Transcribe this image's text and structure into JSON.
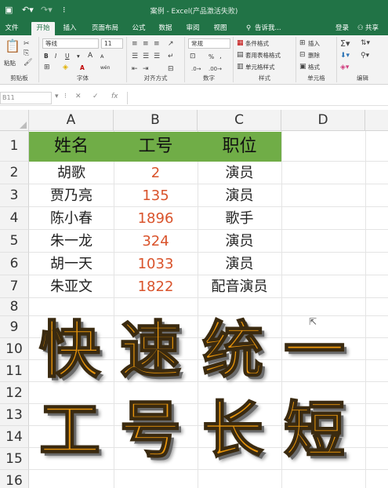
{
  "titlebar": {
    "title": "案例 - Excel(产品激活失败)",
    "save_icon": "save-icon",
    "undo_icon": "undo-icon",
    "redo_icon": "redo-icon"
  },
  "tabs": [
    "文件",
    "开始",
    "插入",
    "页面布局",
    "公式",
    "数据",
    "审阅",
    "视图"
  ],
  "active_tab": "开始",
  "tell_me": "告诉我...",
  "login": "登录",
  "share": "共享",
  "ribbon": {
    "clipboard": {
      "paste": "粘贴",
      "label": "剪贴板"
    },
    "font": {
      "name": "等线",
      "size": "11",
      "bold": "B",
      "italic": "I",
      "underline": "U",
      "grow": "A",
      "shrink": "A",
      "color_a": "A",
      "wen": "wén",
      "label": "字体"
    },
    "alignment": {
      "label": "对齐方式"
    },
    "number": {
      "format": "常规",
      "label": "数字",
      "percent": "%"
    },
    "styles": {
      "conditional": "条件格式",
      "table": "套用表格格式",
      "cell": "单元格样式",
      "label": "样式"
    },
    "cells": {
      "insert": "插入",
      "delete": "删除",
      "format": "格式",
      "label": "单元格"
    },
    "editing": {
      "label": "编辑"
    }
  },
  "formula_bar": {
    "name_box": "B11",
    "cancel": "✕",
    "enter": "✓",
    "fx": "fx",
    "value": ""
  },
  "columns": [
    "A",
    "B",
    "C",
    "D"
  ],
  "rows": [
    "1",
    "2",
    "3",
    "4",
    "5",
    "6",
    "7",
    "8",
    "9",
    "10",
    "11",
    "12",
    "13",
    "14",
    "15",
    "16"
  ],
  "table": {
    "headers": [
      "姓名",
      "工号",
      "职位"
    ],
    "header_color": "#70ad47",
    "number_color": "#d9532b",
    "data": [
      [
        "胡歌",
        "2",
        "演员"
      ],
      [
        "贾乃亮",
        "135",
        "演员"
      ],
      [
        "陈小春",
        "1896",
        "歌手"
      ],
      [
        "朱一龙",
        "324",
        "演员"
      ],
      [
        "胡一天",
        "1033",
        "演员"
      ],
      [
        "朱亚文",
        "1822",
        "配音演员"
      ]
    ]
  },
  "overlay": {
    "line1": [
      "快",
      "速",
      "统",
      "一"
    ],
    "line2": [
      "工",
      "号",
      "长",
      "短"
    ],
    "color": "#e8950c"
  }
}
